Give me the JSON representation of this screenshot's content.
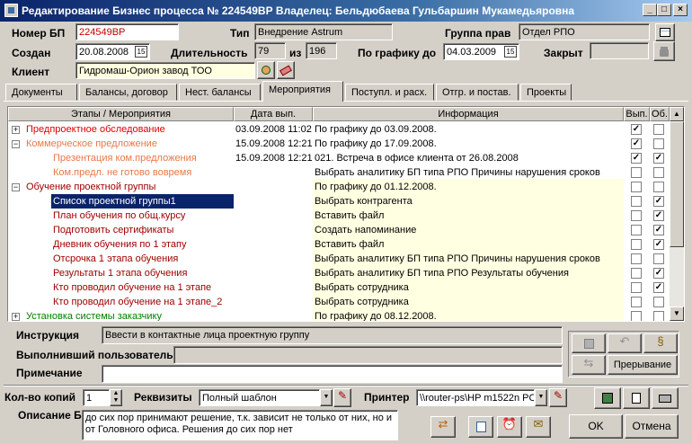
{
  "window": {
    "title": "Редактирование Бизнес процесса № 224549ВР Владелец: Бельдюбаева Гульбаршин Мукамедьяровна"
  },
  "header": {
    "nomer_label": "Номер БП",
    "nomer_value": "224549ВР",
    "tip_label": "Тип",
    "tip_value": "Внедрение Astrum",
    "gruppa_label": "Группа прав",
    "gruppa_value": "Отдел РПО",
    "sozdan_label": "Создан",
    "sozdan_value": "20.08.2008",
    "dlit_label": "Длительность",
    "dlit_value": "79",
    "iz_label": "из",
    "iz_value": "196",
    "pografiku_label": "По графику до",
    "pografiku_value": "04.03.2009",
    "zakryt_label": "Закрыт",
    "klient_label": "Клиент",
    "klient_value": "Гидромаш-Орион  завод ТОО"
  },
  "tabs": [
    "Документы",
    "Балансы, договор",
    "Нест. балансы",
    "Мероприятия",
    "Поступл. и расх.",
    "Отгр. и постав.",
    "Проекты"
  ],
  "grid": {
    "columns": [
      "Этапы / Мероприятия",
      "Дата вып.",
      "Информация",
      "Вып.",
      "Об."
    ],
    "rows": [
      {
        "name": "Предпроектное обследование",
        "date": "03.09.2008 11:02",
        "info": "По графику до 03.09.2008.",
        "vyp": "✓",
        "ob": "",
        "color": "#e00000",
        "lvl": 0,
        "pm": "+"
      },
      {
        "name": "Коммерческое предложение",
        "date": "15.09.2008 12:21",
        "info": "По графику до 17.09.2008.",
        "vyp": "✓",
        "ob": "",
        "color": "#e8784a",
        "lvl": 0,
        "pm": "−"
      },
      {
        "name": "Презентация ком.предложения",
        "date": "15.09.2008 12:21",
        "info": "021. Встреча в офисе клиента от 26.08.2008",
        "vyp": "✓",
        "ob": "✓",
        "color": "#e8784a",
        "lvl": 1,
        "pm": ""
      },
      {
        "name": "Ком.предл. не готово вовремя",
        "date": "",
        "info": "Выбрать аналитику БП типа РПО Причины нарушения сроков",
        "vyp": "",
        "ob": "",
        "color": "#e8784a",
        "lvl": 1,
        "pm": ""
      },
      {
        "name": "Обучение проектной группы",
        "date": "",
        "info": "По графику до 01.12.2008.",
        "vyp": "",
        "ob": "",
        "color": "#a00000",
        "lvl": 0,
        "pm": "−"
      },
      {
        "name": "Список проектной группы1",
        "date": "",
        "info": "Выбрать контрагента",
        "vyp": "",
        "ob": "✓",
        "color": "#fff",
        "lvl": 1,
        "pm": "",
        "sel": true
      },
      {
        "name": "План обучения по общ.курсу",
        "date": "",
        "info": "Вставить файл",
        "vyp": "",
        "ob": "✓",
        "color": "#a00000",
        "lvl": 1,
        "pm": ""
      },
      {
        "name": "Подготовить сертификаты",
        "date": "",
        "info": "Создать напоминание",
        "vyp": "",
        "ob": "✓",
        "color": "#a00000",
        "lvl": 1,
        "pm": ""
      },
      {
        "name": "Дневник обучения по 1 этапу",
        "date": "",
        "info": "Вставить файл",
        "vyp": "",
        "ob": "✓",
        "color": "#a00000",
        "lvl": 1,
        "pm": ""
      },
      {
        "name": "Отсрочка 1 этапа обучения",
        "date": "",
        "info": "Выбрать аналитику БП типа РПО Причины нарушения сроков",
        "vyp": "",
        "ob": "",
        "color": "#a00000",
        "lvl": 1,
        "pm": ""
      },
      {
        "name": "Результаты 1 этапа обучения",
        "date": "",
        "info": "Выбрать аналитику БП типа РПО Результаты обучения",
        "vyp": "",
        "ob": "✓",
        "color": "#a00000",
        "lvl": 1,
        "pm": ""
      },
      {
        "name": "Кто проводил обучение на 1 этапе",
        "date": "",
        "info": "Выбрать сотрудника",
        "vyp": "",
        "ob": "✓",
        "color": "#a00000",
        "lvl": 1,
        "pm": ""
      },
      {
        "name": "Кто проводил обучение на 1 этапе_2",
        "date": "",
        "info": "Выбрать сотрудника",
        "vyp": "",
        "ob": "",
        "color": "#a00000",
        "lvl": 1,
        "pm": ""
      },
      {
        "name": "Установка системы заказчику",
        "date": "",
        "info": "По графику до 08.12.2008.",
        "vyp": "",
        "ob": "",
        "color": "#008000",
        "lvl": 0,
        "pm": "+"
      }
    ]
  },
  "bottom": {
    "instr_label": "Инструкция",
    "instr_value": "Ввести в контактные лица проектную группу",
    "vypoln_label": "Выполнивший пользователь",
    "vypoln_value": "",
    "prim_label": "Примечание",
    "prim_value": "",
    "preryv_label": "Прерывание",
    "kopii_label": "Кол-во копий",
    "kopii_value": "1",
    "rekv_label": "Реквизиты",
    "rekv_value": "Полный шаблон",
    "printer_label": "Принтер",
    "printer_value": "\\\\router-ps\\HP m1522n PC",
    "opis_label": "Описание БП",
    "opis_value": "до сих пор принимают решение, т.к. зависит не только от них,  но и от Головного офиса. Решения до сих пор нет",
    "ok_label": "OK",
    "cancel_label": "Отмена"
  }
}
